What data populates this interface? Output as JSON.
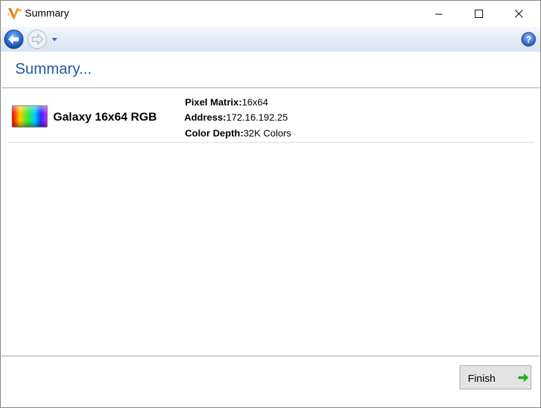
{
  "window": {
    "title": "Summary"
  },
  "header": {
    "title": "Summary..."
  },
  "device": {
    "name": "Galaxy 16x64 RGB",
    "properties": [
      {
        "label": "Pixel Matrix:",
        "value": "16x64"
      },
      {
        "label": "Address:",
        "value": "172.16.192.25"
      },
      {
        "label": "Color Depth:",
        "value": "32K Colors"
      }
    ]
  },
  "footer": {
    "finish_label": "Finish"
  },
  "icons": {
    "app": "v-logo-icon",
    "back": "back-arrow-icon",
    "forward": "forward-arrow-icon",
    "dropdown": "chevron-down-icon",
    "help": "help-icon",
    "finish": "green-arrow-right-icon"
  },
  "colors": {
    "header_text": "#1e5aa5",
    "nav_button": "#2b6fd1",
    "finish_arrow": "#1db820"
  }
}
